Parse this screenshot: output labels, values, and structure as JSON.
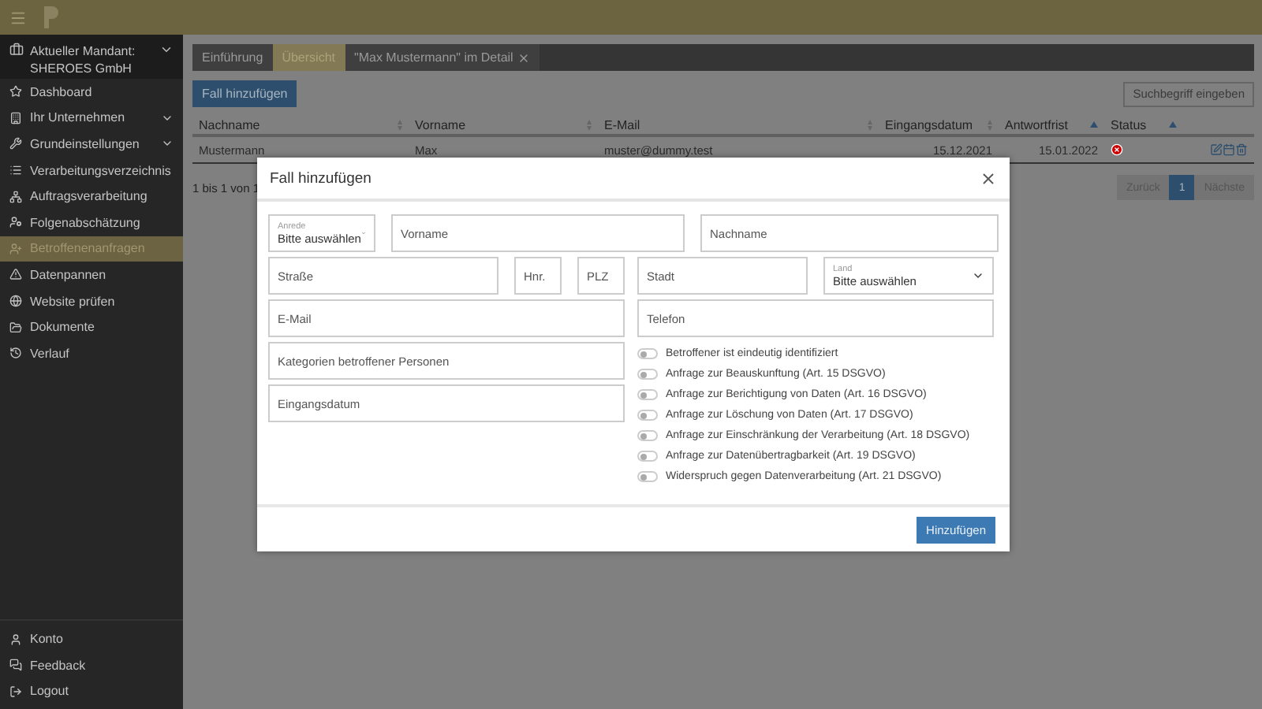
{
  "sidebar": {
    "mandant": {
      "label": "Aktueller Mandant:",
      "name": "SHEROES GmbH",
      "expandable": true
    },
    "items": [
      {
        "label": "Dashboard",
        "expandable": false,
        "selected": false
      },
      {
        "label": "Ihr Unternehmen",
        "expandable": true,
        "selected": false
      },
      {
        "label": "Grundeinstellungen",
        "expandable": true,
        "selected": false
      },
      {
        "label": "Verarbeitungsverzeichnis",
        "expandable": false,
        "selected": false
      },
      {
        "label": "Auftragsverarbeitung",
        "expandable": false,
        "selected": false
      },
      {
        "label": "Folgenabschätzung",
        "expandable": false,
        "selected": false
      },
      {
        "label": "Betroffenenanfragen",
        "expandable": false,
        "selected": true
      },
      {
        "label": "Datenpannen",
        "expandable": false,
        "selected": false
      },
      {
        "label": "Website prüfen",
        "expandable": false,
        "selected": false
      },
      {
        "label": "Dokumente",
        "expandable": false,
        "selected": false
      },
      {
        "label": "Verlauf",
        "expandable": false,
        "selected": false
      }
    ],
    "footer_items": [
      {
        "label": "Konto"
      },
      {
        "label": "Feedback"
      },
      {
        "label": "Logout"
      }
    ]
  },
  "tabs": [
    {
      "label": "Einführung",
      "selected": false,
      "closable": false
    },
    {
      "label": "Übersicht",
      "selected": true,
      "closable": false
    },
    {
      "label": "\"Max Mustermann\" im Detail",
      "selected": false,
      "closable": true
    }
  ],
  "add_button": "Fall hinzufügen",
  "search": {
    "placeholder": "Suchbegriff eingeben"
  },
  "table": {
    "columns": [
      {
        "label": "Nachname",
        "sorted": false
      },
      {
        "label": "Vorname",
        "sorted": false
      },
      {
        "label": "E-Mail",
        "sorted": false
      },
      {
        "label": "Eingangsdatum",
        "sorted": false
      },
      {
        "label": "Antwortfrist",
        "sorted": true
      },
      {
        "label": "Status",
        "sorted": true
      }
    ],
    "rows": [
      {
        "cells": [
          "Mustermann",
          "Max",
          "muster@dummy.test",
          "15.12.2021",
          "15.01.2022"
        ]
      }
    ]
  },
  "info": "1 bis 1 von 1",
  "pagination": {
    "prev": "Zurück",
    "pages": [
      {
        "label": "1",
        "selected": true
      }
    ],
    "next": "Nächste"
  },
  "modal": {
    "title": "Fall hinzufügen",
    "salutation": {
      "label": "Anrede",
      "value": "Bitte auswählen"
    },
    "first_name": {
      "placeholder": "Vorname"
    },
    "last_name": {
      "placeholder": "Nachname"
    },
    "street": {
      "placeholder": "Straße"
    },
    "house_no": {
      "placeholder": "Hnr."
    },
    "zip": {
      "placeholder": "PLZ"
    },
    "city": {
      "placeholder": "Stadt"
    },
    "country": {
      "label": "Land",
      "value": "Bitte auswählen"
    },
    "email": {
      "placeholder": "E-Mail"
    },
    "phone": {
      "placeholder": "Telefon"
    },
    "categories": {
      "placeholder": "Kategorien betroffener Personen"
    },
    "received": {
      "placeholder": "Eingangsdatum"
    },
    "toggles": [
      {
        "label": "Betroffener ist eindeutig identifiziert",
        "on": false
      },
      {
        "label": "Anfrage zur Beauskunftung (Art. 15 DSGVO)",
        "on": false
      },
      {
        "label": "Anfrage zur Berichtigung von Daten (Art. 16 DSGVO)",
        "on": false
      },
      {
        "label": "Anfrage zur Löschung von Daten (Art. 17 DSGVO)",
        "on": false
      },
      {
        "label": "Anfrage zur Einschränkung der Verarbeitung (Art. 18 DSGVO)",
        "on": false
      },
      {
        "label": "Anfrage zur Datenübertragbarkeit (Art. 19 DSGVO)",
        "on": false
      },
      {
        "label": "Widerspruch gegen Datenverarbeitung (Art. 21 DSGVO)",
        "on": false
      }
    ],
    "submit": "Hinzufügen"
  }
}
